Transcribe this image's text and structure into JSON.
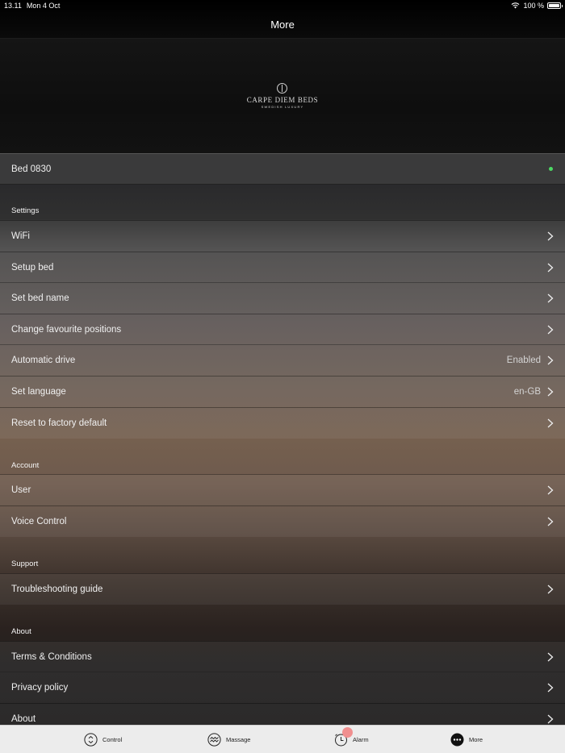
{
  "status_bar": {
    "time": "13.11",
    "date": "Mon 4 Oct",
    "battery": "100 %"
  },
  "nav": {
    "title": "More"
  },
  "logo": {
    "name": "CARPE DIEM BEDS",
    "tagline": "SWEDISH LUXURY"
  },
  "bed": {
    "name": "Bed 0830",
    "status_color": "#4cd964"
  },
  "sections": {
    "settings": {
      "title": "Settings",
      "items": [
        {
          "label": "WiFi",
          "value": ""
        },
        {
          "label": "Setup bed",
          "value": ""
        },
        {
          "label": "Set bed name",
          "value": ""
        },
        {
          "label": "Change favourite positions",
          "value": ""
        },
        {
          "label": "Automatic drive",
          "value": "Enabled"
        },
        {
          "label": "Set language",
          "value": "en-GB"
        },
        {
          "label": "Reset to factory default",
          "value": ""
        }
      ]
    },
    "account": {
      "title": "Account",
      "items": [
        {
          "label": "User"
        },
        {
          "label": "Voice Control"
        }
      ]
    },
    "support": {
      "title": "Support",
      "items": [
        {
          "label": "Troubleshooting guide"
        }
      ]
    },
    "about": {
      "title": "About",
      "items": [
        {
          "label": "Terms & Conditions"
        },
        {
          "label": "Privacy policy"
        },
        {
          "label": "About"
        }
      ]
    }
  },
  "tabs": [
    {
      "label": "Control",
      "icon": "control-icon"
    },
    {
      "label": "Massage",
      "icon": "massage-icon"
    },
    {
      "label": "Alarm",
      "icon": "alarm-icon"
    },
    {
      "label": "More",
      "icon": "more-icon"
    }
  ],
  "colors": {
    "alarm_badge": "#f08f8f",
    "tab_bar": "#ececec"
  }
}
